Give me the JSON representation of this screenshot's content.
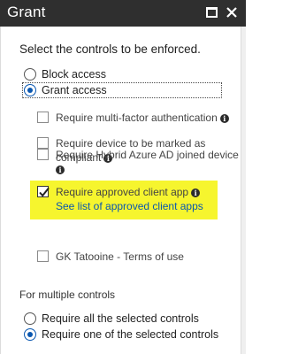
{
  "header": {
    "title": "Grant"
  },
  "main": {
    "heading": "Select the controls to be enforced.",
    "access_options": [
      {
        "label": "Block access",
        "selected": false
      },
      {
        "label": "Grant access",
        "selected": true
      }
    ],
    "controls": [
      {
        "line1": "Require multi-factor authentication",
        "line2": "",
        "checked": false,
        "info": true
      },
      {
        "line1": "Require device to be marked as",
        "line2": "compliant",
        "checked": false,
        "info": true
      },
      {
        "line1": "Require Hybrid Azure AD joined device",
        "line2": "",
        "checked": false,
        "info": true
      },
      {
        "line1": "Require approved client app",
        "link": "See list of approved client apps",
        "checked": true,
        "info": true,
        "highlighted": true
      },
      {
        "line1": "GK Tatooine - Terms of use",
        "checked": false,
        "info": false
      }
    ],
    "multiple_heading": "For multiple controls",
    "multiple_options": [
      {
        "label": "Require all the selected controls",
        "selected": false
      },
      {
        "label": "Require one of the selected controls",
        "selected": true
      }
    ]
  },
  "colors": {
    "titlebar": "#2f2f2f",
    "accent": "#0a57b0",
    "highlight": "#f6f52e"
  },
  "icons": [
    "maximize-icon",
    "close-icon",
    "info-icon",
    "checkmark-icon"
  ]
}
